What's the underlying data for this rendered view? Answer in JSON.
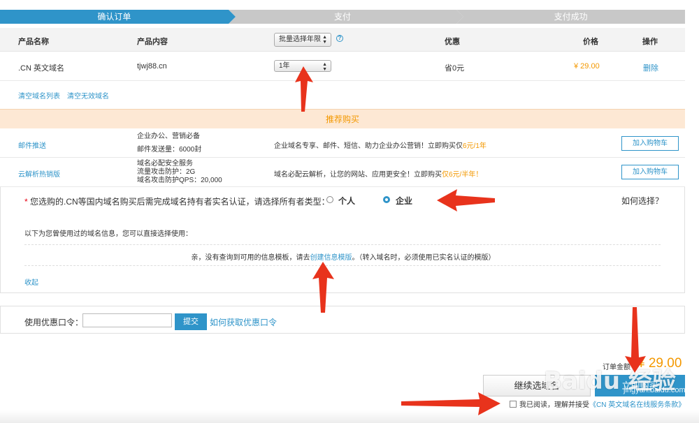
{
  "steps": [
    "确认订单",
    "支付",
    "支付成功"
  ],
  "table": {
    "headers": {
      "product_name": "产品名称",
      "product_content": "产品内容",
      "batch_select": "批量选择年限",
      "discount": "优惠",
      "price": "价格",
      "action": "操作"
    },
    "row": {
      "name": ".CN 英文域名",
      "content": "tjwj88.cn",
      "year": "1年",
      "discount": "省0元",
      "price": "¥ 29.00",
      "delete": "删除"
    }
  },
  "links": {
    "clear_list": "清空域名列表",
    "clear_invalid": "清空无效域名"
  },
  "recommend": {
    "title": "推荐购买",
    "items": [
      {
        "name": "邮件推送",
        "desc1": "企业办公、营销必备",
        "desc2": "邮件发送量：6000封",
        "msg": "企业域名专享、邮件、短信、助力企业办公营销！立即购买仅",
        "price": "6元/1年",
        "button": "加入购物车"
      },
      {
        "name": "云解析热销版",
        "desc1": "域名必配安全服务",
        "desc2": "流量攻击防护：2G",
        "desc3": "域名攻击防护QPS：20,000",
        "msg": "域名必配云解析，让您的网站、应用更安全！立即购买",
        "price": "仅6元/半年！",
        "button": "加入购物车"
      }
    ]
  },
  "owner": {
    "star": "*",
    "question": "您选购的.CN等国内域名购买后需完成域名持有者实名认证，请选择所有者类型：",
    "personal": "个人",
    "enterprise": "企业",
    "how": "如何选择？",
    "hint": "以下为您曾使用过的域名信息，您可以直接选择使用：",
    "empty_pre": "亲，没有查询到可用的信息模板，请去",
    "empty_link": "创建信息模版",
    "empty_post": "。（转入域名时，必须使用已实名认证的模版）",
    "collapse": "收起"
  },
  "coupon": {
    "label": "使用优惠口令：",
    "value": "",
    "submit": "提交",
    "how": "如何获取优惠口令"
  },
  "checkout": {
    "total_label": "订单金额",
    "total": "¥ 29.00",
    "continue": "继续选域名",
    "buy": "立即购买",
    "agree_pre": "我已阅读，理解并接受",
    "agree_link": "《CN 英文域名在线服务条款》"
  },
  "watermark": {
    "text": "Baidu 经验",
    "sub": "jingyan.baidu.com"
  },
  "colors": {
    "primary": "#2f94c9",
    "orange": "#f39800",
    "annotation_arrow": "#e8331c"
  }
}
